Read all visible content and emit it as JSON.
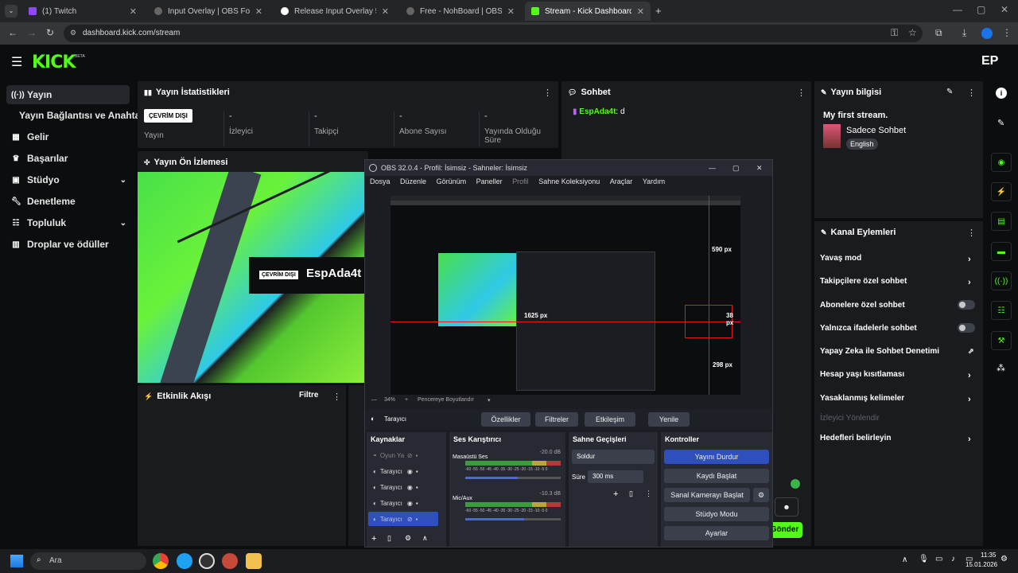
{
  "tabs": [
    {
      "label": "(1) Twitch",
      "color": "#9146ff"
    },
    {
      "label": "Input Overlay | OBS Forums",
      "color": "#3b3b3b"
    },
    {
      "label": "Release Input Overlay 5.0.6 · uni",
      "color": "#ffffff"
    },
    {
      "label": "Free - NohBoard | OBS Forums",
      "color": "#3b3b3b"
    },
    {
      "label": "Stream - Kick Dashboard",
      "color": "#53fc18"
    }
  ],
  "address": {
    "url": "dashboard.kick.com/stream"
  },
  "kick": {
    "logo": "KICK",
    "beta": "BETA",
    "avatar_initials": "EP"
  },
  "sidebar": {
    "items": [
      {
        "label": "Yayın",
        "icon": "broadcast-icon"
      },
      {
        "label": "Yayın Bağlantısı ve Anahtarı",
        "icon": ""
      },
      {
        "label": "Gelir",
        "icon": "revenue-icon"
      },
      {
        "label": "Başarılar",
        "icon": "trophy-icon"
      },
      {
        "label": "Stüdyo",
        "icon": "studio-icon"
      },
      {
        "label": "Denetleme",
        "icon": "wrench-icon"
      },
      {
        "label": "Topluluk",
        "icon": "community-icon"
      },
      {
        "label": "Droplar ve ödüller",
        "icon": "drops-icon"
      }
    ]
  },
  "stats": {
    "title": "Yayın İstatistikleri",
    "offline_badge": "ÇEVRİM DIŞI",
    "status_label": "Yayın",
    "items": [
      {
        "value": "-",
        "label": "İzleyici"
      },
      {
        "value": "-",
        "label": "Takipçi"
      },
      {
        "value": "-",
        "label": "Abone Sayısı"
      },
      {
        "value": "-",
        "label": "Yayında Olduğu Süre"
      }
    ]
  },
  "preview": {
    "title": "Yayın Ön İzlemesi",
    "badge": "ÇEVRİM DIŞI",
    "channel": "EspAda4t"
  },
  "activity": {
    "title": "Etkinlik Akışı",
    "filter": "Filtre"
  },
  "chat": {
    "title": "Sohbet",
    "user": "EspAda4t",
    "message": ": d",
    "send": "Gönder"
  },
  "info": {
    "title": "Yayın bilgisi",
    "stream_title": "My first stream.",
    "category": "Sadece Sohbet",
    "tag": "English"
  },
  "actions": {
    "title": "Kanal Eylemleri",
    "items": [
      {
        "label": "Yavaş mod",
        "control": "chevron"
      },
      {
        "label": "Takipçilere özel sohbet",
        "control": "chevron"
      },
      {
        "label": "Abonelere özel sohbet",
        "control": "toggle"
      },
      {
        "label": "Yalnızca ifadelerle sohbet",
        "control": "toggle"
      },
      {
        "label": "Yapay Zeka ile Sohbet Denetimi",
        "control": "external"
      },
      {
        "label": "Hesap yaşı kısıtlaması",
        "control": "chevron"
      },
      {
        "label": "Yasaklanmış kelimeler",
        "control": "chevron"
      },
      {
        "label": "İzleyici Yönlendir",
        "control": "none"
      },
      {
        "label": "Hedefleri belirleyin",
        "control": "chevron"
      }
    ]
  },
  "obs": {
    "title": "OBS 32.0.4 - Profil: İsimsiz - Sahneler: İsimsiz",
    "menu": [
      "Dosya",
      "Düzenle",
      "Görünüm",
      "Paneller",
      "Profil",
      "Sahne Koleksiyonu",
      "Araçlar",
      "Yardım"
    ],
    "measures": [
      "590 px",
      "1625 px",
      "38 px",
      "298 px"
    ],
    "zoom": "34%",
    "fit": "Pencereye Boyutlandır",
    "source_name": "Tarayıcı",
    "src_buttons": [
      "Özellikler",
      "Filtreler",
      "Etkileşim",
      "Yenile"
    ],
    "docks": {
      "sources": "Kaynaklar",
      "mixer": "Ses Karıştırıcı",
      "transitions": "Sahne Geçişleri",
      "controls": "Kontroller"
    },
    "sources": [
      "Oyun Yakalama",
      "Tarayıcı",
      "Tarayıcı",
      "Tarayıcı",
      "Tarayıcı"
    ],
    "mixer": [
      {
        "name": "Masaüstü Ses",
        "db": "-20.0 dB",
        "level": 0.55
      },
      {
        "name": "Mic/Aux",
        "db": "-10.3 dB",
        "level": 0.62
      }
    ],
    "meter_ticks": "-60 -55 -50 -45 -40 -35 -30 -25 -20 -15 -10 -5 0",
    "transition": "Soldur",
    "duration_label": "Süre",
    "duration": "300 ms",
    "control_buttons": [
      "Yayını Durdur",
      "Kaydı Başlat",
      "Sanal Kamerayı Başlat",
      "Stüdyo Modu",
      "Ayarlar"
    ]
  },
  "taskbar": {
    "search": "Ara",
    "time": "11:35",
    "date": "15.01.2026"
  }
}
